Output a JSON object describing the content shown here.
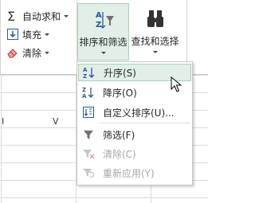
{
  "ribbon": {
    "autosum": {
      "label": "自动求和",
      "icon": "sigma-icon"
    },
    "fill": {
      "label": "填充",
      "icon": "fill-down-icon"
    },
    "clear": {
      "label": "清除",
      "icon": "eraser-icon"
    },
    "sort_filter": {
      "label": "排序和筛选",
      "icon": "sort-filter-icon"
    },
    "find_select": {
      "label": "查找和选择",
      "icon": "binoculars-icon"
    }
  },
  "grid": {
    "cell_marks": [
      "I",
      "V"
    ]
  },
  "menu": {
    "items": [
      {
        "label": "升序(S)",
        "icon": "sort-ascending-icon",
        "enabled": true,
        "highlighted": true
      },
      {
        "label": "降序(O)",
        "icon": "sort-descending-icon",
        "enabled": true,
        "highlighted": false
      },
      {
        "label": "自定义排序(U)...",
        "icon": "custom-sort-icon",
        "enabled": true,
        "highlighted": false
      },
      {
        "label": "筛选(F)",
        "icon": "filter-icon",
        "enabled": true,
        "highlighted": false
      },
      {
        "label": "清除(C)",
        "icon": "clear-filter-icon",
        "enabled": false,
        "highlighted": false
      },
      {
        "label": "重新应用(Y)",
        "icon": "reapply-filter-icon",
        "enabled": false,
        "highlighted": false
      }
    ]
  },
  "colors": {
    "highlight_bg": "#e1efe6",
    "highlight_border": "#a8d2b4",
    "disabled_text": "#a6a6a6",
    "accent_blue": "#2b579a",
    "accent_red": "#c0392b"
  }
}
